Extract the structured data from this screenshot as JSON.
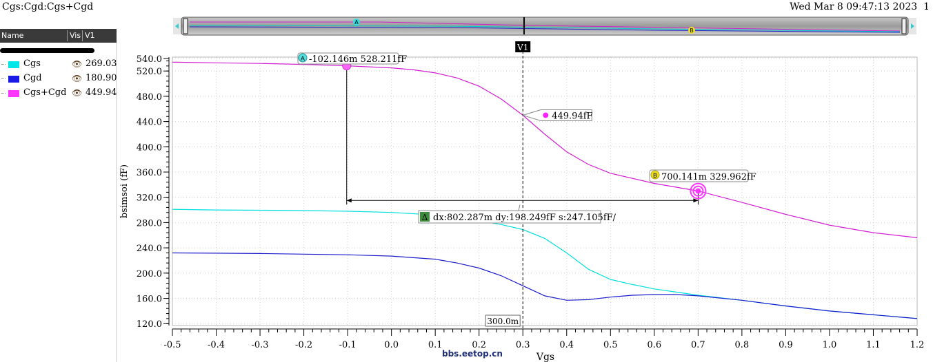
{
  "window": {
    "title": "Cgs:Cgd:Cgs+Cgd",
    "datetime": "Wed Mar 8 09:47:13 2023",
    "page_number": "1"
  },
  "legend": {
    "headers": {
      "name": "Name",
      "vis": "Vis",
      "v1": "V1"
    },
    "eye_icon": "eye-icon",
    "items": [
      {
        "name": "Cgs",
        "color": "#00e5e5",
        "value": "269.034"
      },
      {
        "name": "Cgd",
        "color": "#1a1ae6",
        "value": "180.906"
      },
      {
        "name": "Cgs+Cgd",
        "color": "#ff33ff",
        "value": "449.94f"
      }
    ]
  },
  "overview": {
    "marker_a": "A",
    "marker_b": "B"
  },
  "markers": {
    "A": {
      "letter": "A",
      "label": "-102.146m 528.211fF"
    },
    "B": {
      "letter": "B",
      "label": "700.141m 329.962fF"
    },
    "cursor_point": "449.94fF",
    "delta": {
      "symbol": "Δ",
      "label": "dx:802.287m dy:198.249fF s:247.105fF/"
    },
    "vertical_cursor": {
      "name": "V1",
      "x_label": "300.0m"
    }
  },
  "watermark": "bbs.eetop.cn",
  "chart_data": {
    "type": "line",
    "xlabel": "Vgs",
    "ylabel": "bsimsoi (fF)",
    "xlim": [
      -0.5,
      1.2
    ],
    "ylim": [
      117,
      542
    ],
    "xticks": [
      -0.5,
      -0.4,
      -0.3,
      -0.2,
      -0.1,
      0.0,
      0.1,
      0.2,
      0.3,
      0.4,
      0.5,
      0.6,
      0.7,
      0.8,
      0.9,
      1.0,
      1.1,
      1.2
    ],
    "xtick_labels": [
      "-0.5",
      "-0.4",
      "-0.3",
      "-0.2",
      "-0.1",
      "0.0",
      "0.1",
      "0.2",
      "0.3",
      "0.4",
      "0.5",
      "0.6",
      "0.7",
      "0.8",
      "0.9",
      "1.0",
      "1.1",
      "1.2"
    ],
    "yticks": [
      120,
      160,
      200,
      240,
      280,
      320,
      360,
      400,
      440,
      480,
      520,
      540
    ],
    "ytick_labels": [
      "120.0",
      "160.0",
      "200.0",
      "240.0",
      "280.0",
      "320.0",
      "360.0",
      "400.0",
      "440.0",
      "480.0",
      "520.0",
      "540.0"
    ],
    "grid": true,
    "series": [
      {
        "name": "Cgs",
        "color": "#00dede",
        "x": [
          -0.5,
          -0.4,
          -0.3,
          -0.2,
          -0.1,
          0.0,
          0.1,
          0.15,
          0.2,
          0.25,
          0.3,
          0.35,
          0.4,
          0.45,
          0.5,
          0.55,
          0.6,
          0.65,
          0.7,
          0.8,
          0.9,
          1.0,
          1.1,
          1.2
        ],
        "y": [
          301,
          300,
          299.5,
          299,
          298,
          296,
          292,
          288,
          283,
          277,
          269,
          255,
          232,
          206,
          190,
          182,
          175,
          170,
          165,
          157,
          148,
          140,
          134,
          128
        ]
      },
      {
        "name": "Cgd",
        "color": "#1a1acc",
        "x": [
          -0.5,
          -0.4,
          -0.3,
          -0.2,
          -0.1,
          0.0,
          0.1,
          0.15,
          0.2,
          0.25,
          0.3,
          0.35,
          0.4,
          0.45,
          0.5,
          0.55,
          0.6,
          0.65,
          0.7,
          0.8,
          0.9,
          1.0,
          1.1,
          1.2
        ],
        "y": [
          232,
          231.5,
          231,
          230,
          229,
          227,
          222,
          216,
          208,
          196,
          180,
          164,
          157,
          158,
          162,
          165,
          166,
          166,
          164,
          157,
          148,
          140,
          134,
          128
        ]
      },
      {
        "name": "Cgs+Cgd",
        "color": "#d21ed2",
        "x": [
          -0.5,
          -0.4,
          -0.3,
          -0.2,
          -0.1,
          0.0,
          0.05,
          0.1,
          0.15,
          0.2,
          0.25,
          0.3,
          0.35,
          0.4,
          0.45,
          0.5,
          0.6,
          0.7,
          0.8,
          0.9,
          1.0,
          1.1,
          1.2
        ],
        "y": [
          534,
          533,
          532,
          530.5,
          528.2,
          525,
          522,
          517,
          509,
          496,
          476,
          450,
          420,
          392,
          372,
          358,
          342,
          330,
          312,
          293,
          276,
          264,
          256
        ]
      }
    ]
  }
}
